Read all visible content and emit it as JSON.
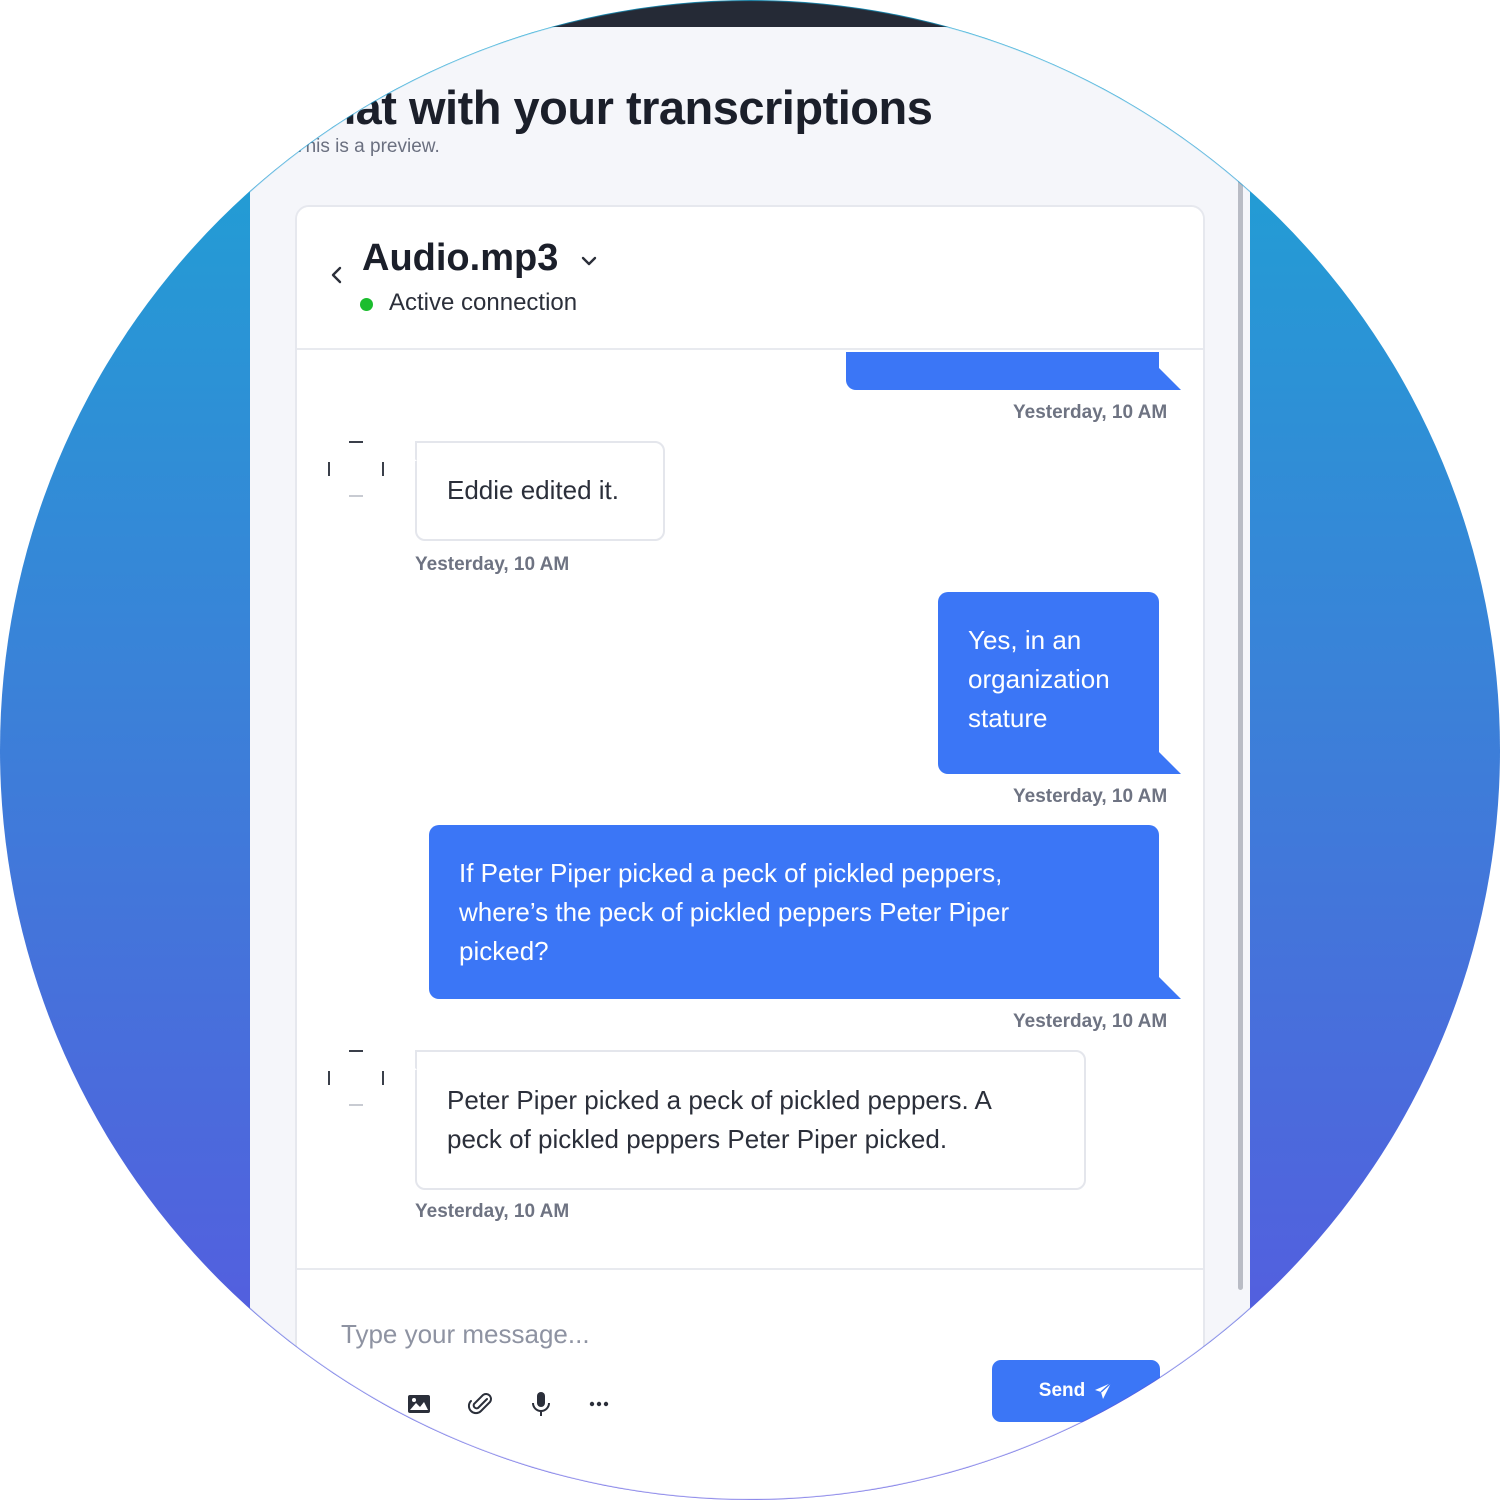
{
  "page": {
    "title": "Chat with your transcriptions",
    "subtitle": "This is a preview."
  },
  "chat_header": {
    "file_name": "Audio.mp3",
    "status": "Active connection",
    "status_color": "#1bbd2e"
  },
  "messages": [
    {
      "direction": "outgoing",
      "text": "",
      "time": "Yesterday, 10 AM"
    },
    {
      "direction": "incoming",
      "text": "Eddie edited it.",
      "time": "Yesterday, 10 AM"
    },
    {
      "direction": "outgoing",
      "lines": [
        "Yes, in an",
        "organization",
        "stature"
      ],
      "time": "Yesterday, 10 AM"
    },
    {
      "direction": "outgoing",
      "lines": [
        "If Peter Piper picked a peck of pickled peppers,",
        "where’s the peck of pickled peppers Peter Piper",
        "picked?"
      ],
      "time": "Yesterday, 10 AM"
    },
    {
      "direction": "incoming",
      "lines": [
        "Peter Piper picked a peck of pickled peppers. A",
        "peck of pickled peppers Peter Piper picked."
      ],
      "time": "Yesterday, 10 AM"
    }
  ],
  "composer": {
    "placeholder": "Type your message...",
    "send_label": "Send",
    "tools": [
      "history-icon",
      "image-icon",
      "paperclip-icon",
      "microphone-icon",
      "more-icon"
    ]
  },
  "colors": {
    "accent": "#3b76f6",
    "gradient_top": "#1aa6d3",
    "gradient_bottom": "#5a55e0",
    "topbar": "#252a36"
  }
}
